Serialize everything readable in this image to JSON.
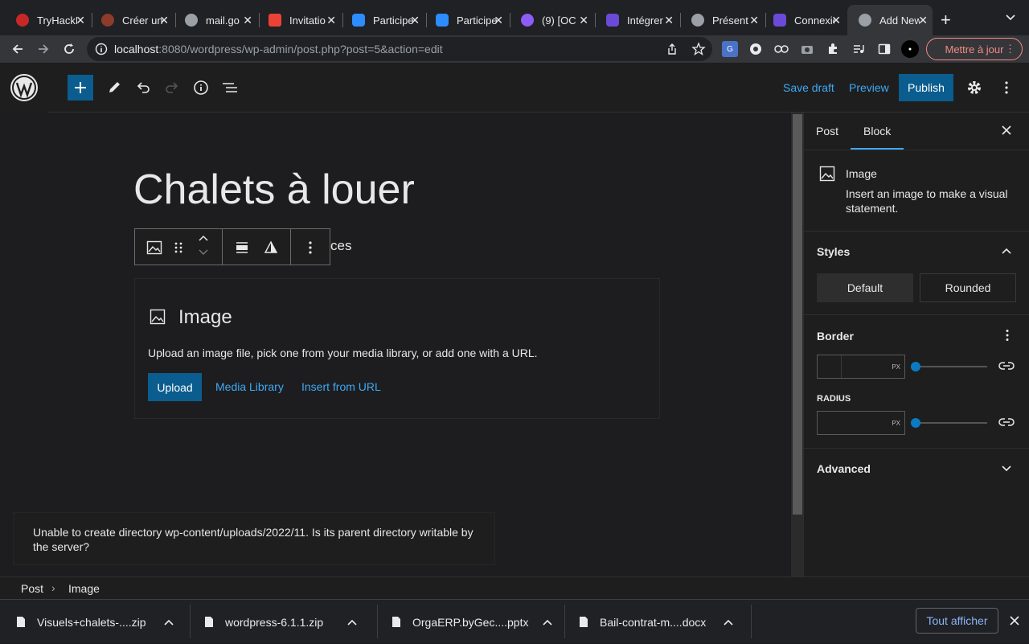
{
  "browser": {
    "tabs": [
      {
        "title": "TryHackMe",
        "fav_color": "#c62828"
      },
      {
        "title": "Créer un",
        "fav_color": "#8d3b2b"
      },
      {
        "title": "mail.go",
        "fav_color": "#9aa0a6"
      },
      {
        "title": "Invitatio",
        "fav_color": "#ea4335"
      },
      {
        "title": "Participer",
        "fav_color": "#2d8cff"
      },
      {
        "title": "Participer",
        "fav_color": "#2d8cff"
      },
      {
        "title": "(9) [OC",
        "fav_color": "#8e5cf7"
      },
      {
        "title": "Intégrer",
        "fav_color": "#6c4ad8"
      },
      {
        "title": "Présent",
        "fav_color": "#9aa0a6"
      },
      {
        "title": "Connexion",
        "fav_color": "#6c4ad8"
      },
      {
        "title": "Add New",
        "fav_color": "#9aa0a6"
      }
    ],
    "new_tab": "+",
    "url_host": "localhost",
    "url_rest": ":8080/wordpress/wp-admin/post.php?post=5&action=edit",
    "update_label": "Mettre à jour"
  },
  "editor": {
    "save_draft": "Save draft",
    "preview": "Preview",
    "publish": "Publish",
    "post_title": "Chalets à louer",
    "hidden_text_tail": "ces",
    "image_block": {
      "label": "Image",
      "help": "Upload an image file, pick one from your media library, or add one with a URL.",
      "upload": "Upload",
      "media_library": "Media Library",
      "insert_url": "Insert from URL"
    },
    "notice": "Unable to create directory wp-content/uploads/2022/11. Is its parent directory writable by the server?"
  },
  "sidebar": {
    "tab_post": "Post",
    "tab_block": "Block",
    "block_name": "Image",
    "block_desc": "Insert an image to make a visual statement.",
    "styles_heading": "Styles",
    "style_default": "Default",
    "style_rounded": "Rounded",
    "border_heading": "Border",
    "radius_label": "RADIUS",
    "unit": "PX",
    "advanced_heading": "Advanced"
  },
  "breadcrumb": {
    "root": "Post",
    "sep": "›",
    "current": "Image"
  },
  "downloads": {
    "items": [
      "Visuels+chalets-....zip",
      "wordpress-6.1.1.zip",
      "OrgaERP.byGec....pptx",
      "Bail-contrat-m....docx"
    ],
    "show_all": "Tout afficher"
  }
}
